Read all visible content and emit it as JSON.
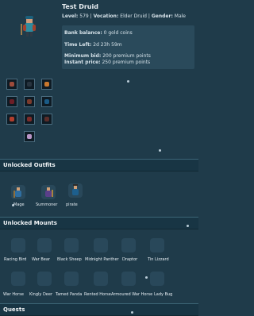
{
  "character": {
    "name": "Test Druid",
    "level_label": "Level:",
    "level": "579",
    "vocation_label": "Vocation:",
    "vocation": "Elder Druid",
    "gender_label": "Gender:",
    "gender": "Male",
    "bank_label": "Bank balance:",
    "bank": "0 gold coins",
    "time_left_label": "Time Left:",
    "time_left": "2d 23h 59m",
    "minimum_bid_label": "Minimum bid:",
    "minimum_bid": "200 premium points",
    "instant_price_label": "Instant price:",
    "instant_price": "250 premium points"
  },
  "sections": {
    "outfits": "Unlocked Outfits",
    "mounts": "Unlocked Mounts",
    "quests": "Quests"
  },
  "outfits": [
    "Mage",
    "Summoner",
    "pirate"
  ],
  "mounts_row1": [
    "Racing Bird",
    "War Bear",
    "Black Sheep",
    "Midnight Panther",
    "Draptor",
    "Tin Lizzard"
  ],
  "mounts_row2": [
    "War Horse",
    "Kingly Deer",
    "Tamed Panda",
    "Rented Horse",
    "Armoured War Horse",
    "Lady Bug"
  ],
  "colors": {
    "background": "#1f3b4a",
    "panel": "#2a4a5b",
    "header": "#183544"
  }
}
